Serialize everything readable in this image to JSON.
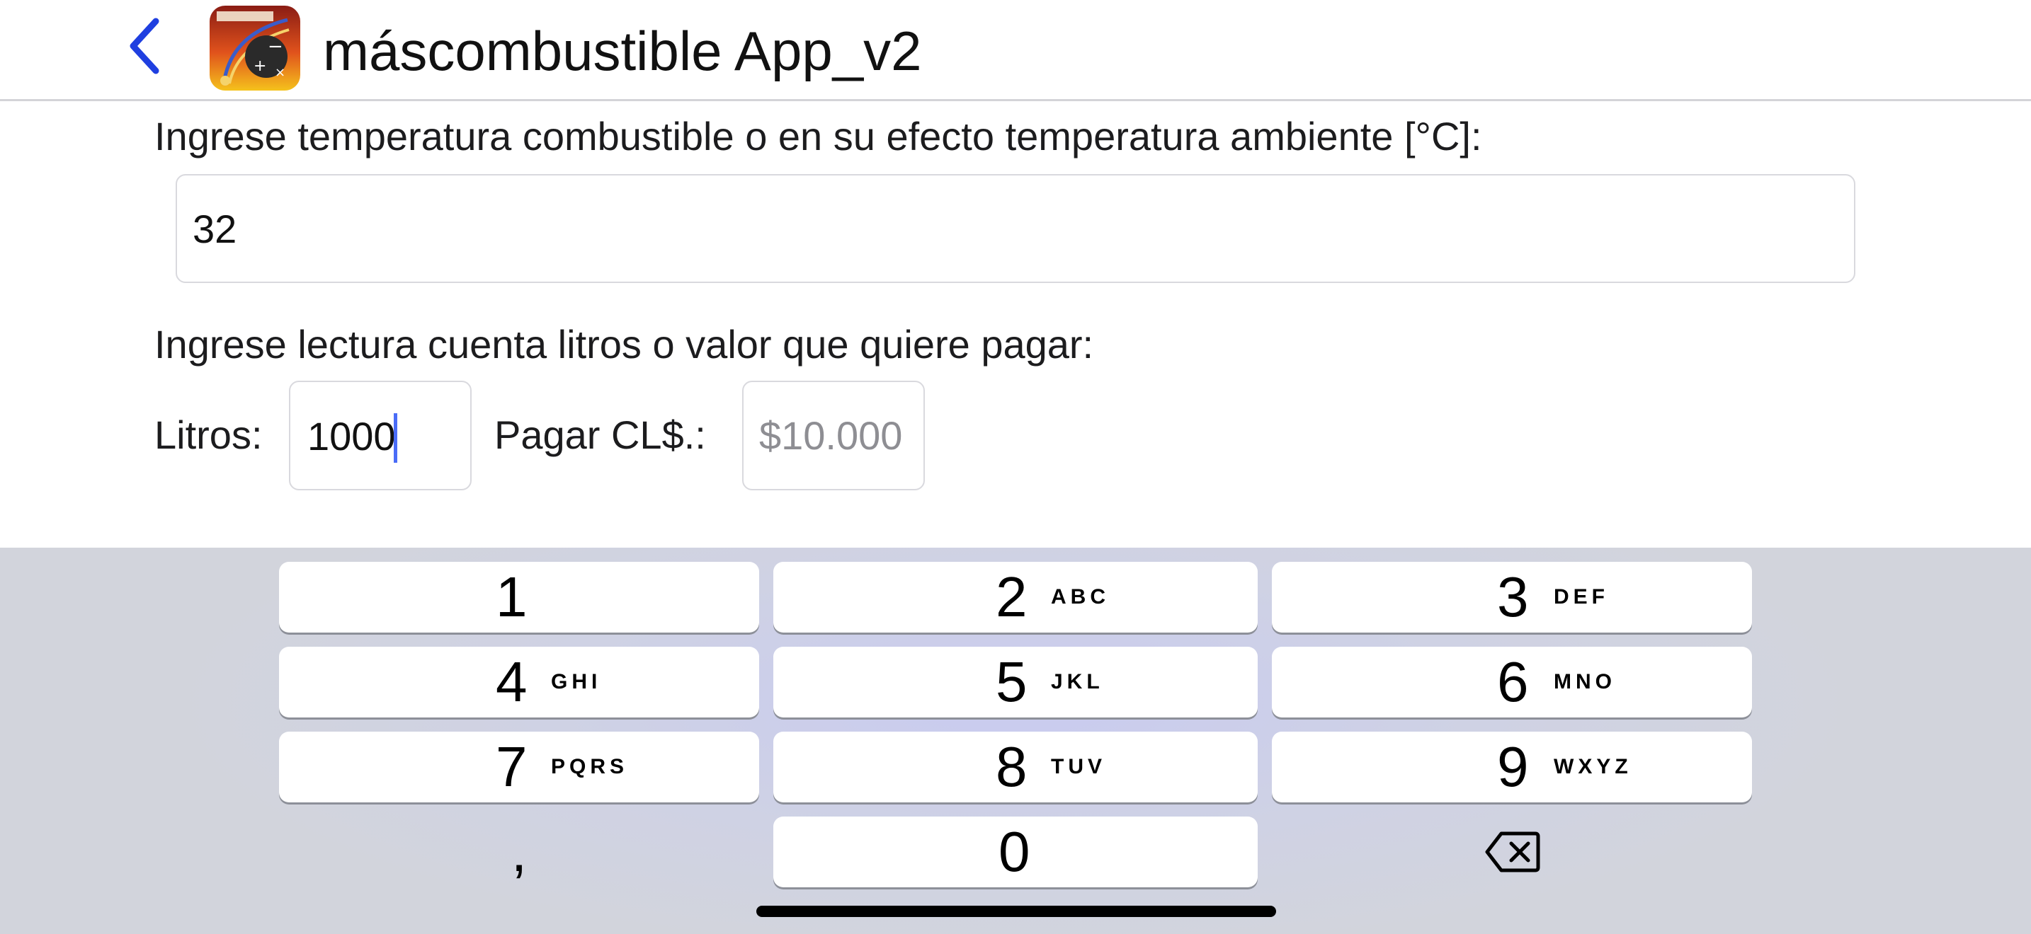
{
  "header": {
    "title": "máscombustible App_v2",
    "back_icon": "chevron-left-icon",
    "accent_color": "#1f3fe0"
  },
  "form": {
    "temperature_label": "Ingrese temperatura combustible o en su efecto temperatura ambiente [°C]:",
    "temperature_value": "32",
    "reading_label": "Ingrese lectura cuenta litros o valor que quiere pagar:",
    "litros_label": "Litros:",
    "litros_value": "1000",
    "pagar_label": "Pagar CL$.:",
    "pagar_placeholder": "$10.000"
  },
  "keyboard": {
    "keys": [
      {
        "num": "1",
        "sub": ""
      },
      {
        "num": "2",
        "sub": "ABC"
      },
      {
        "num": "3",
        "sub": "DEF"
      },
      {
        "num": "4",
        "sub": "GHI"
      },
      {
        "num": "5",
        "sub": "JKL"
      },
      {
        "num": "6",
        "sub": "MNO"
      },
      {
        "num": "7",
        "sub": "PQRS"
      },
      {
        "num": "8",
        "sub": "TUV"
      },
      {
        "num": "9",
        "sub": "WXYZ"
      },
      {
        "num": "0",
        "sub": ""
      }
    ],
    "comma": ",",
    "delete_icon": "backspace-icon"
  }
}
